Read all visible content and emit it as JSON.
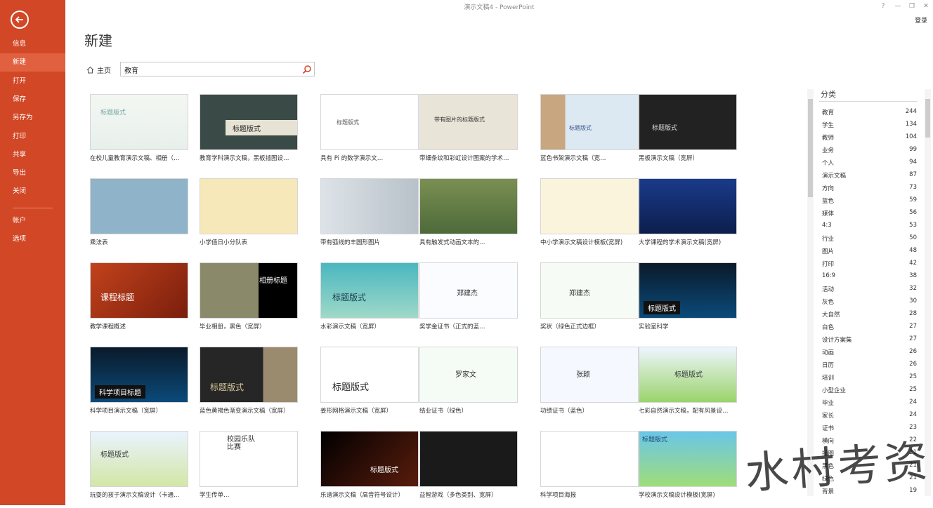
{
  "window": {
    "title": "演示文稿4 - PowerPoint",
    "help": "?",
    "minimize": "—",
    "restore": "❐",
    "close": "✕",
    "login": "登录"
  },
  "sidebar": {
    "back_icon": "back-arrow-icon",
    "items": [
      "信息",
      "新建",
      "打开",
      "保存",
      "另存为",
      "打印",
      "共享",
      "导出",
      "关闭",
      "帐户",
      "选项"
    ],
    "active": "新建",
    "accent": "#d24726"
  },
  "page": {
    "heading": "新建",
    "home": "主页",
    "search_value": "教育"
  },
  "templates": [
    {
      "label": "在校儿童教育演示文稿、相册（…",
      "thumb_text": "标题版式"
    },
    {
      "label": "教育学科演示文稿，黑板插图设…",
      "thumb_text": "标题版式"
    },
    {
      "label": "具有 Pi 的数学演示文…",
      "thumb_text": "标题版式"
    },
    {
      "label": "带细条纹和彩虹设计图案的学术…",
      "thumb_text": "带有图片的标题版式"
    },
    {
      "label": "蓝色书架演示文稿（宽…",
      "thumb_text": "标题版式"
    },
    {
      "label": "黑板演示文稿（宽屏）",
      "thumb_text": "标题版式"
    },
    {
      "label": "乘法表",
      "thumb_text": ""
    },
    {
      "label": "小学值日小分队表",
      "thumb_text": ""
    },
    {
      "label": "带有弧线的丰圆形图片",
      "thumb_text": ""
    },
    {
      "label": "具有触发式动画文本的…",
      "thumb_text": ""
    },
    {
      "label": "中小学演示文稿设计模板(宽屏)",
      "thumb_text": ""
    },
    {
      "label": "大学课程的学术演示文稿(宽屏)",
      "thumb_text": ""
    },
    {
      "label": "教学课程概述",
      "thumb_text": "课程标题"
    },
    {
      "label": "毕业相册，黑色（宽屏）",
      "thumb_text": "相册标题"
    },
    {
      "label": "水彩演示文稿（宽屏）",
      "thumb_text": "标题版式"
    },
    {
      "label": "奖学金证书（正式的蓝…",
      "thumb_text": "郑建杰"
    },
    {
      "label": "奖状（绿色正式边框）",
      "thumb_text": "郑建杰"
    },
    {
      "label": "实验室科学",
      "thumb_text": "标题版式"
    },
    {
      "label": "科学项目演示文稿（宽屏）",
      "thumb_text": "科学项目标题"
    },
    {
      "label": "蓝色黄褐色渐变演示文稿（宽屏）",
      "thumb_text": "标题版式"
    },
    {
      "label": "姜形网格演示文稿（宽屏）",
      "thumb_text": "标题版式"
    },
    {
      "label": "结业证书（绿色）",
      "thumb_text": "罗家文"
    },
    {
      "label": "功绩证书（蓝色）",
      "thumb_text": "张颖"
    },
    {
      "label": "七彩自然演示文稿，配有风景设…",
      "thumb_text": "标题版式"
    },
    {
      "label": "玩耍的孩子演示文稿设计（卡通…",
      "thumb_text": "标题版式"
    },
    {
      "label": "学生传单…",
      "thumb_text": "校园乐队比赛"
    },
    {
      "label": "乐谱演示文稿（高音符号设计）",
      "thumb_text": "标题版式"
    },
    {
      "label": "益智游戏（多色类别、宽屏）",
      "thumb_text": ""
    },
    {
      "label": "科学项目海报",
      "thumb_text": ""
    },
    {
      "label": "学校演示文稿设计模板(宽屏)",
      "thumb_text": "标题版式"
    }
  ],
  "categories_title": "分类",
  "categories": [
    {
      "name": "教育",
      "count": "244"
    },
    {
      "name": "学生",
      "count": "134"
    },
    {
      "name": "教师",
      "count": "104"
    },
    {
      "name": "业务",
      "count": "99"
    },
    {
      "name": "个人",
      "count": "94"
    },
    {
      "name": "演示文稿",
      "count": "87"
    },
    {
      "name": "方向",
      "count": "73"
    },
    {
      "name": "蓝色",
      "count": "59"
    },
    {
      "name": "媒体",
      "count": "56"
    },
    {
      "name": "4:3",
      "count": "53"
    },
    {
      "name": "行业",
      "count": "50"
    },
    {
      "name": "图片",
      "count": "48"
    },
    {
      "name": "打印",
      "count": "42"
    },
    {
      "name": "16:9",
      "count": "38"
    },
    {
      "name": "活动",
      "count": "32"
    },
    {
      "name": "灰色",
      "count": "30"
    },
    {
      "name": "大自然",
      "count": "28"
    },
    {
      "name": "白色",
      "count": "27"
    },
    {
      "name": "设计方案集",
      "count": "27"
    },
    {
      "name": "动画",
      "count": "26"
    },
    {
      "name": "日历",
      "count": "26"
    },
    {
      "name": "培训",
      "count": "25"
    },
    {
      "name": "小型企业",
      "count": "25"
    },
    {
      "name": "毕业",
      "count": "24"
    },
    {
      "name": "家长",
      "count": "24"
    },
    {
      "name": "证书",
      "count": "23"
    },
    {
      "name": "横向",
      "count": "22"
    },
    {
      "name": "插图",
      "count": "21"
    },
    {
      "name": "黑色",
      "count": "21"
    },
    {
      "name": "绿色",
      "count": "21"
    },
    {
      "name": "背景",
      "count": "19"
    }
  ],
  "watermark": "水村考资"
}
